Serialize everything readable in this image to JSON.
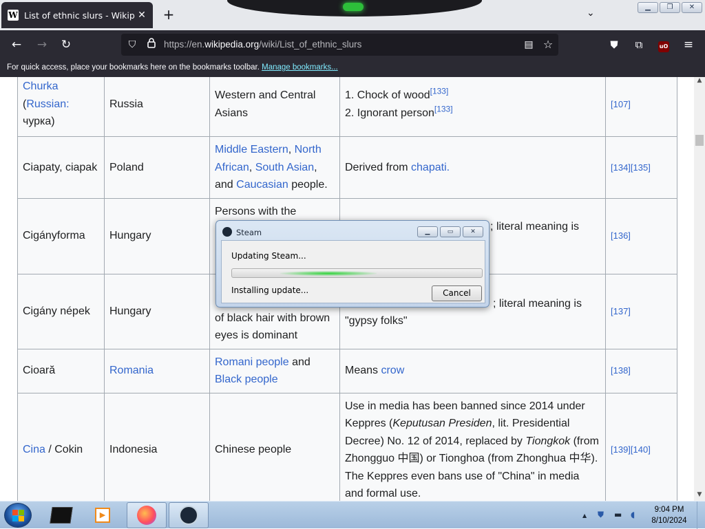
{
  "browser": {
    "tab_title": "List of ethnic slurs - Wikipedia",
    "favicon_letter": "W",
    "tab_close": "✕",
    "new_tab": "+",
    "tab_list": "⌄",
    "url_prefix": "https://en.",
    "url_host": "wikipedia.org",
    "url_path": "/wiki/List_of_ethnic_slurs",
    "bookmarks_msg": "For quick access, place your bookmarks here on the bookmarks toolbar.",
    "bookmarks_link": "Manage bookmarks..."
  },
  "table": {
    "rows": [
      {
        "term_link": "Churka",
        "term_extra": "(",
        "term_link2": "Russian:",
        "term_tail": " чурка)",
        "location": "Russia",
        "target": "Western and Central Asians",
        "meaning_1": "1. Chock of wood",
        "ref_a": "[133]",
        "meaning_2": "2. Ignorant person",
        "ref_b": "[133]",
        "refs": "[107]"
      },
      {
        "term": "Ciapaty, ciapak",
        "location": "Poland",
        "target_links": [
          "Middle Eastern",
          "North African",
          "South Asian",
          "Caucasian"
        ],
        "target_sep1": ", ",
        "target_sep2": ", ",
        "target_sep3": ", and ",
        "target_tail": " people.",
        "meaning_text": "Derived from ",
        "meaning_link": "chapati.",
        "refs": "[134][135]"
      },
      {
        "term": "Cigányforma",
        "location": "Hungary",
        "target": "Persons with the",
        "meaning": "; literal meaning is",
        "refs": "[136]"
      },
      {
        "term": "Cigány népek",
        "location": "Hungary",
        "target_line2": "of black hair with brown",
        "target_line3": "eyes is dominant",
        "meaning_1": "; literal meaning is",
        "meaning_2": "\"gypsy folks\"",
        "refs": "[137]"
      },
      {
        "term": "Cioară",
        "location_link": "Romania",
        "target_link1": "Romani people",
        "target_and": " and ",
        "target_link2": "Black people",
        "meaning_text": "Means ",
        "meaning_link": "crow",
        "refs": "[138]"
      },
      {
        "term_link": "Cina",
        "term_tail": " / Cokin",
        "location": "Indonesia",
        "target": "Chinese people",
        "m_a": "Use in media has been banned since 2014 under Keppres (",
        "m_b": "Keputusan Presiden",
        "m_c": ", lit. Presidential Decree) No. 12 of 2014, replaced by ",
        "m_d": "Tiongkok",
        "m_e": " (from Zhongguo 中国) or Tionghoa (from Zhonghua 中华). The Keppres even bans use of \"China\" in media and formal use.",
        "refs": "[139][140]"
      }
    ]
  },
  "steam_dialog": {
    "title": "Steam",
    "status": "Updating Steam...",
    "progress": 0.38,
    "substatus": "Installing update...",
    "cancel_label": "Cancel"
  },
  "taskbar": {
    "time": "9:04 PM",
    "date": "8/10/2024",
    "tray_arrow": "▲"
  }
}
